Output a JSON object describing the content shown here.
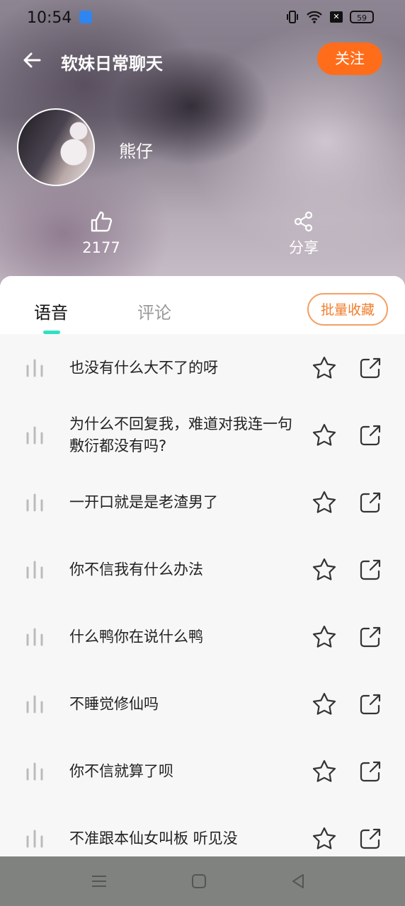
{
  "status_bar": {
    "time": "10:54",
    "battery": "59"
  },
  "header": {
    "title": "软妹日常聊天",
    "follow_label": "关注"
  },
  "profile": {
    "nickname": "熊仔"
  },
  "stats": {
    "likes": "2177",
    "share_label": "分享"
  },
  "tabs": [
    {
      "label": "语音"
    },
    {
      "label": "评论"
    }
  ],
  "batch_button": "批量收藏",
  "items": [
    {
      "text": "也没有什么大不了的呀"
    },
    {
      "text": "为什么不回复我，难道对我连一句敷衍都没有吗?"
    },
    {
      "text": "一开口就是是老渣男了"
    },
    {
      "text": "你不信我有什么办法"
    },
    {
      "text": "什么鸭你在说什么鸭"
    },
    {
      "text": "不睡觉修仙吗"
    },
    {
      "text": "你不信就算了呗"
    },
    {
      "text": "不准跟本仙女叫板 听见没"
    }
  ],
  "colors": {
    "accent": "#ff6d1b",
    "tab_indicator": "#2ee0c3",
    "batch_border": "#f4a065"
  }
}
